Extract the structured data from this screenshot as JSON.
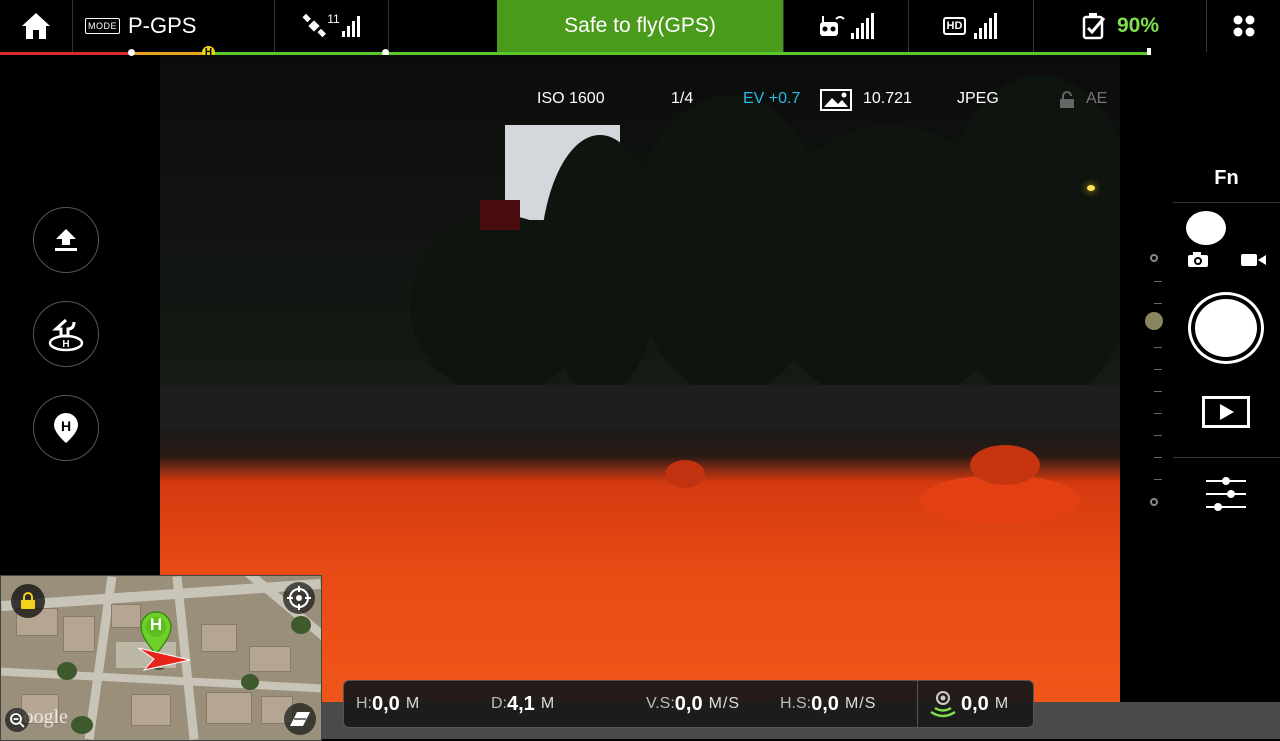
{
  "top_bar": {
    "home_icon": "home-icon",
    "mode_badge": "MODE",
    "flight_mode": "P-GPS",
    "gps_count": "11",
    "status": "Safe to fly(GPS)",
    "hd_badge": "HD",
    "battery_percent": "90%",
    "colors": {
      "status_bg": "#4a9a1c",
      "battery": "#7ee04a"
    }
  },
  "altitude_limit_tag": "--/--",
  "camera_params": {
    "iso": "ISO 1600",
    "shutter": "1/4",
    "ev": "EV +0.7",
    "storage": "10.721",
    "format": "JPEG",
    "ae": "AE",
    "ev_color": "#2ab8e8"
  },
  "right_panel": {
    "fn": "Fn"
  },
  "telemetry": {
    "h_label": "H:",
    "h_value": "0,0",
    "h_unit": "M",
    "d_label": "D:",
    "d_value": "4,1",
    "d_unit": "M",
    "vs_label": "V.S:",
    "vs_value": "0,0",
    "vs_unit": "M/S",
    "hs_label": "H.S:",
    "hs_value": "0,0",
    "hs_unit": "M/S",
    "vps_value": "0,0",
    "vps_unit": "M"
  },
  "map": {
    "home_marker": "H",
    "watermark": "Google"
  }
}
